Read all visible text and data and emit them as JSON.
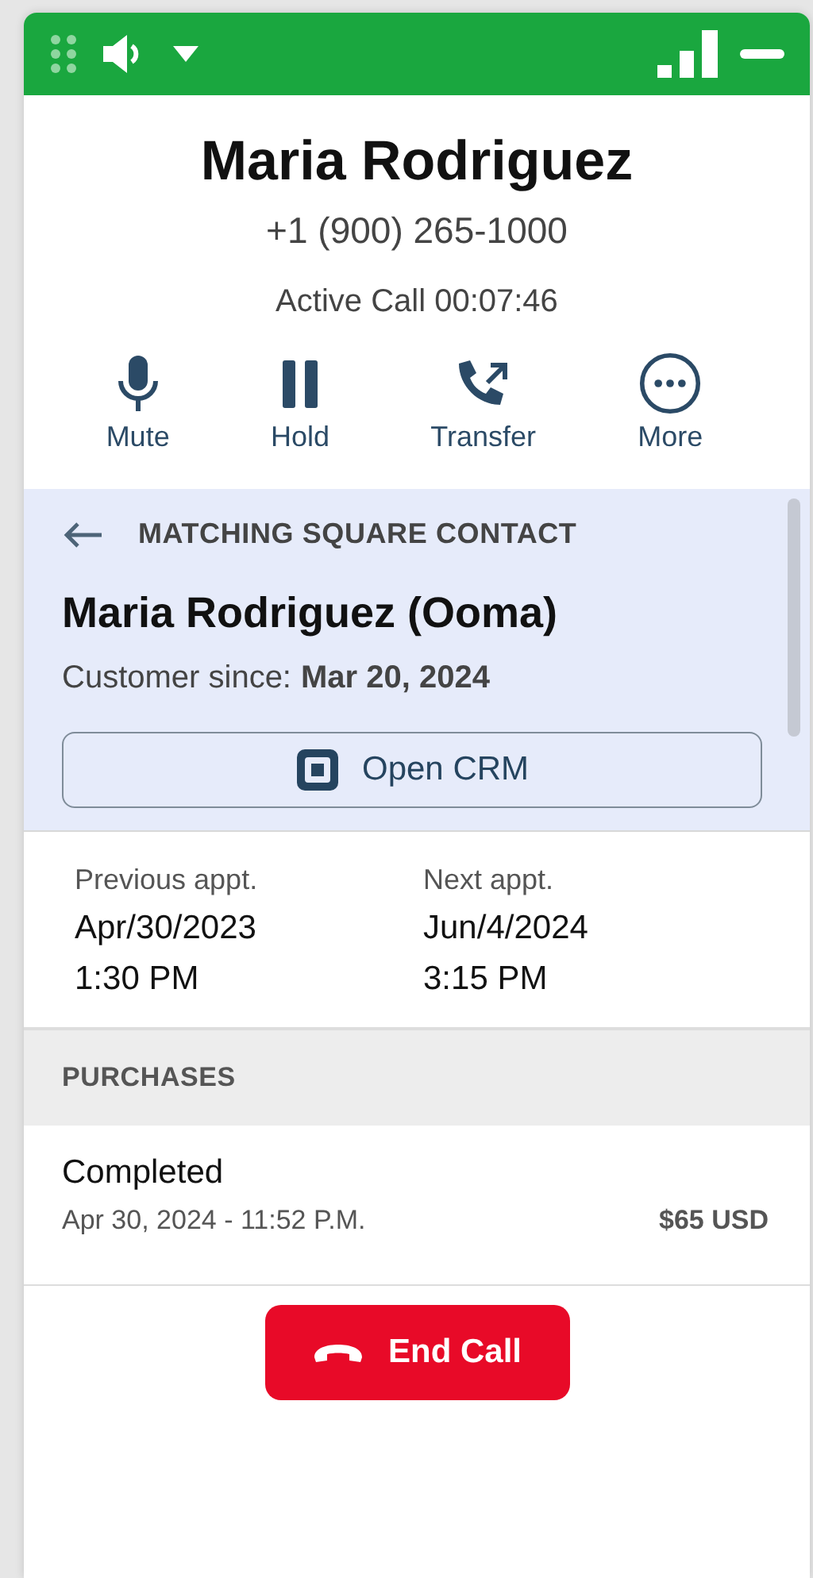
{
  "caller": {
    "name": "Maria Rodriguez",
    "phone": "+1 (900) 265-1000",
    "status": "Active Call 00:07:46"
  },
  "actions": [
    {
      "kind": "mic",
      "label": "Mute"
    },
    {
      "kind": "pause",
      "label": "Hold"
    },
    {
      "kind": "transfer",
      "label": "Transfer"
    },
    {
      "kind": "more",
      "label": "More"
    }
  ],
  "contact": {
    "heading": "MATCHING SQUARE CONTACT",
    "name": "Maria Rodriguez (Ooma)",
    "since_label": "Customer since:",
    "since_value": "Mar 20, 2024",
    "button": "Open CRM"
  },
  "appointments": [
    {
      "label": "Previous appt.",
      "date": "Apr/30/2023",
      "time": "1:30 PM"
    },
    {
      "label": "Next appt.",
      "date": "Jun/4/2024",
      "time": "3:15 PM"
    }
  ],
  "purchases": {
    "heading": "PURCHASES",
    "items": [
      {
        "status": "Completed",
        "date": "Apr 30, 2024 - 11:52 P.M.",
        "amount": "$65 USD"
      }
    ]
  },
  "end_call": "End Call"
}
